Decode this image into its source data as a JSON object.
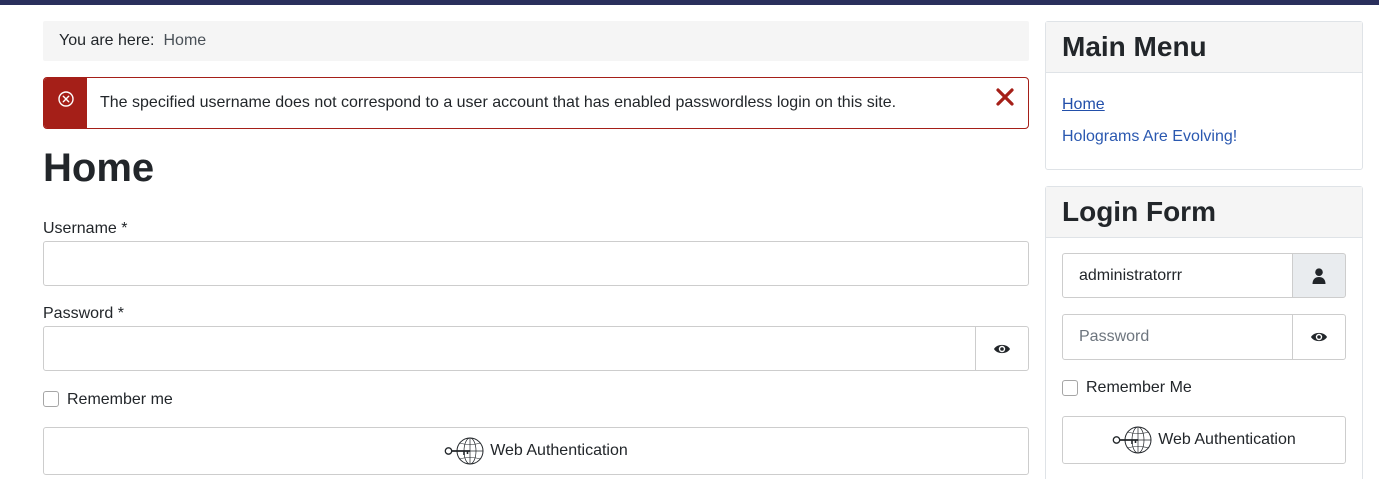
{
  "breadcrumb": {
    "prefix": "You are here:",
    "items": [
      "Home"
    ]
  },
  "alert": {
    "message": "The specified username does not correspond to a user account that has enabled passwordless login on this site.",
    "color": "#a51f18"
  },
  "page": {
    "title": "Home"
  },
  "main_form": {
    "username_label": "Username *",
    "username_value": "",
    "password_label": "Password *",
    "password_value": "",
    "remember_label": "Remember me",
    "webauthn_label": "Web Authentication"
  },
  "sidebar": {
    "main_menu": {
      "title": "Main Menu",
      "items": [
        {
          "label": "Home",
          "current": true
        },
        {
          "label": "Holograms Are Evolving!",
          "current": false
        }
      ]
    },
    "login_form": {
      "title": "Login Form",
      "username_value": "administratorrr",
      "password_placeholder": "Password",
      "remember_label": "Remember Me",
      "webauthn_label": "Web Authentication"
    }
  },
  "colors": {
    "topbar": "#2a2f5c",
    "link": "#2a58b0",
    "error": "#a51f18"
  }
}
